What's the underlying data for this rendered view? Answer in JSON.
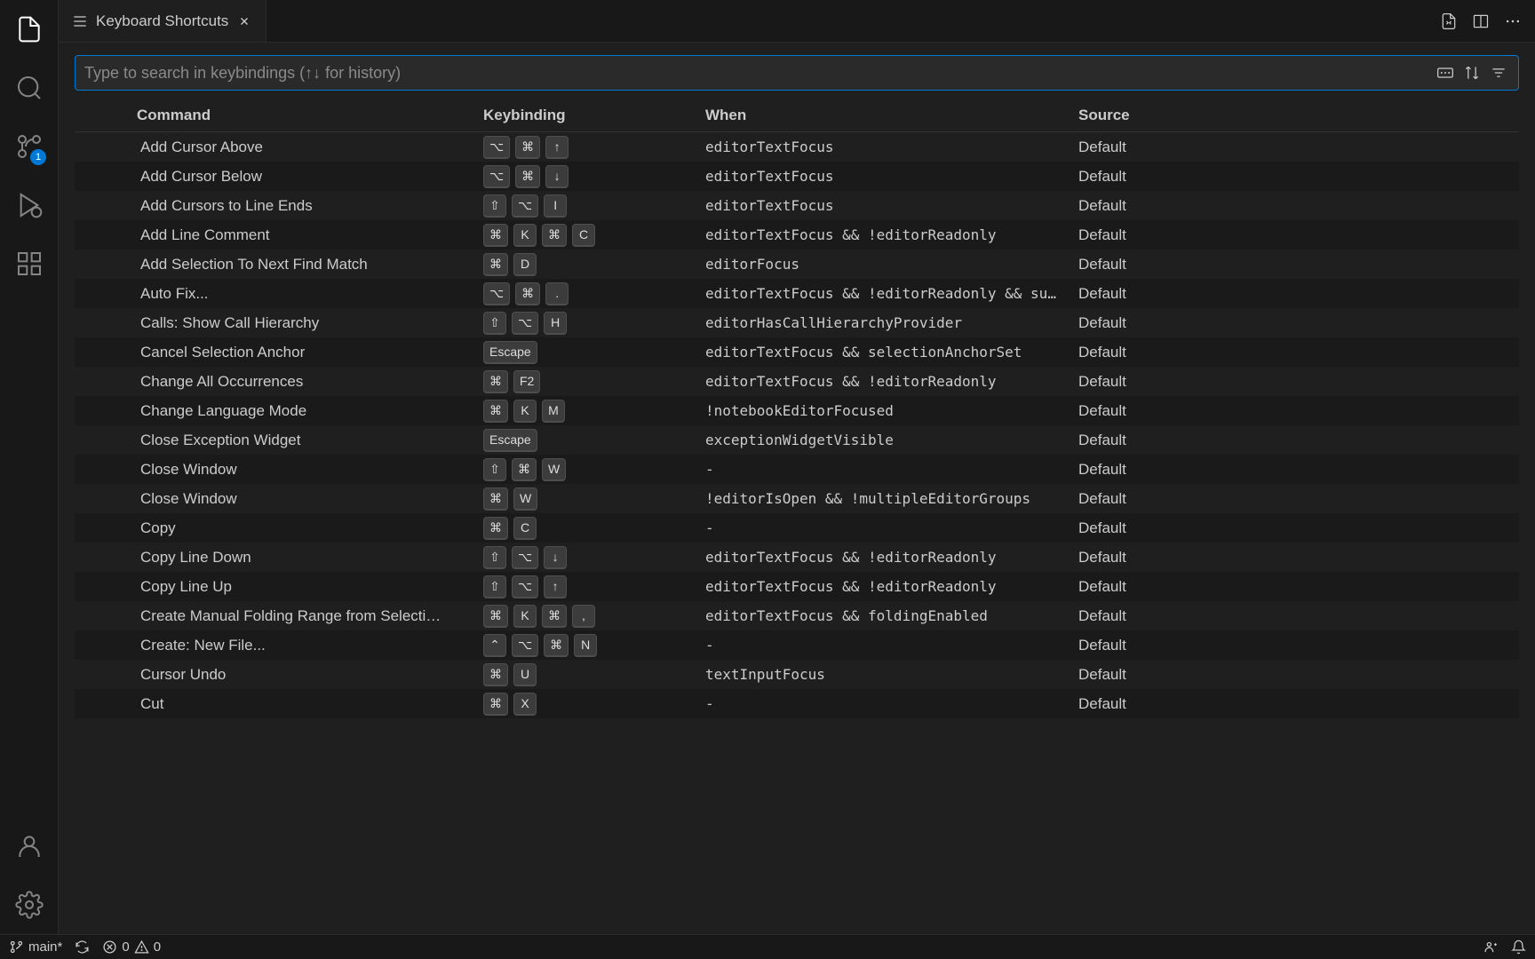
{
  "tab": {
    "title": "Keyboard Shortcuts"
  },
  "search": {
    "placeholder": "Type to search in keybindings (↑↓ for history)"
  },
  "columns": {
    "command": "Command",
    "keybinding": "Keybinding",
    "when": "When",
    "source": "Source"
  },
  "scm_badge": "1",
  "rows": [
    {
      "command": "Add Cursor Above",
      "keys": [
        "⌥",
        "⌘",
        "↑"
      ],
      "when": "editorTextFocus",
      "source": "Default"
    },
    {
      "command": "Add Cursor Below",
      "keys": [
        "⌥",
        "⌘",
        "↓"
      ],
      "when": "editorTextFocus",
      "source": "Default"
    },
    {
      "command": "Add Cursors to Line Ends",
      "keys": [
        "⇧",
        "⌥",
        "I"
      ],
      "when": "editorTextFocus",
      "source": "Default"
    },
    {
      "command": "Add Line Comment",
      "keys": [
        "⌘",
        "K",
        "⌘",
        "C"
      ],
      "when": "editorTextFocus && !editorReadonly",
      "source": "Default"
    },
    {
      "command": "Add Selection To Next Find Match",
      "keys": [
        "⌘",
        "D"
      ],
      "when": "editorFocus",
      "source": "Default"
    },
    {
      "command": "Auto Fix...",
      "keys": [
        "⌥",
        "⌘",
        "."
      ],
      "when": "editorTextFocus && !editorReadonly && su…",
      "source": "Default"
    },
    {
      "command": "Calls: Show Call Hierarchy",
      "keys": [
        "⇧",
        "⌥",
        "H"
      ],
      "when": "editorHasCallHierarchyProvider",
      "source": "Default"
    },
    {
      "command": "Cancel Selection Anchor",
      "keys": [
        "Escape"
      ],
      "when": "editorTextFocus && selectionAnchorSet",
      "source": "Default"
    },
    {
      "command": "Change All Occurrences",
      "keys": [
        "⌘",
        "F2"
      ],
      "when": "editorTextFocus && !editorReadonly",
      "source": "Default"
    },
    {
      "command": "Change Language Mode",
      "keys": [
        "⌘",
        "K",
        "M"
      ],
      "when": "!notebookEditorFocused",
      "source": "Default"
    },
    {
      "command": "Close Exception Widget",
      "keys": [
        "Escape"
      ],
      "when": "exceptionWidgetVisible",
      "source": "Default"
    },
    {
      "command": "Close Window",
      "keys": [
        "⇧",
        "⌘",
        "W"
      ],
      "when": "-",
      "source": "Default"
    },
    {
      "command": "Close Window",
      "keys": [
        "⌘",
        "W"
      ],
      "when": "!editorIsOpen && !multipleEditorGroups",
      "source": "Default"
    },
    {
      "command": "Copy",
      "keys": [
        "⌘",
        "C"
      ],
      "when": "-",
      "source": "Default"
    },
    {
      "command": "Copy Line Down",
      "keys": [
        "⇧",
        "⌥",
        "↓"
      ],
      "when": "editorTextFocus && !editorReadonly",
      "source": "Default"
    },
    {
      "command": "Copy Line Up",
      "keys": [
        "⇧",
        "⌥",
        "↑"
      ],
      "when": "editorTextFocus && !editorReadonly",
      "source": "Default"
    },
    {
      "command": "Create Manual Folding Range from Selecti…",
      "keys": [
        "⌘",
        "K",
        "⌘",
        ","
      ],
      "when": "editorTextFocus && foldingEnabled",
      "source": "Default"
    },
    {
      "command": "Create: New File...",
      "keys": [
        "⌃",
        "⌥",
        "⌘",
        "N"
      ],
      "when": "-",
      "source": "Default"
    },
    {
      "command": "Cursor Undo",
      "keys": [
        "⌘",
        "U"
      ],
      "when": "textInputFocus",
      "source": "Default"
    },
    {
      "command": "Cut",
      "keys": [
        "⌘",
        "X"
      ],
      "when": "-",
      "source": "Default"
    }
  ],
  "status": {
    "branch": "main*",
    "errors": "0",
    "warnings": "0"
  }
}
